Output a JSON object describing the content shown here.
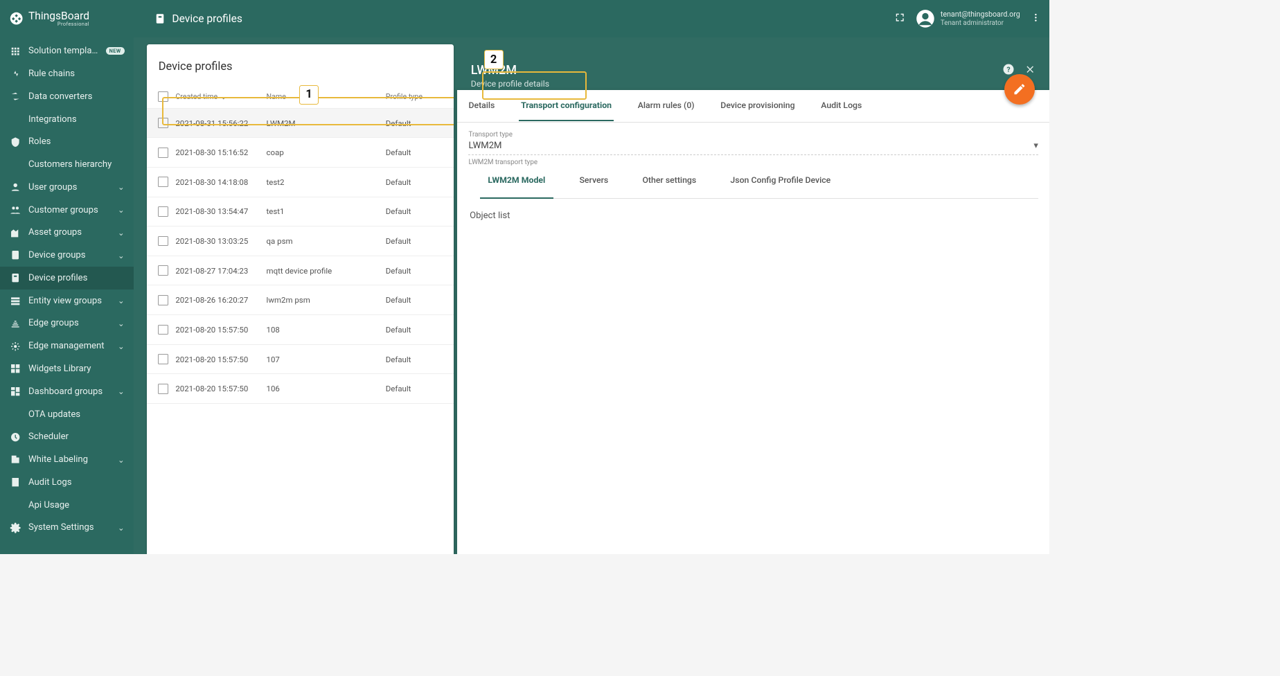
{
  "brand": {
    "name": "ThingsBoard",
    "edition": "Professional"
  },
  "header": {
    "page_title": "Device profiles",
    "user_email": "tenant@thingsboard.org",
    "user_role": "Tenant administrator"
  },
  "sidebar": {
    "items": [
      {
        "icon": "apps",
        "label": "Solution templates",
        "badge": "NEW"
      },
      {
        "icon": "rulechains",
        "label": "Rule chains"
      },
      {
        "icon": "converters",
        "label": "Data converters"
      },
      {
        "icon": "integrations",
        "label": "Integrations"
      },
      {
        "icon": "roles",
        "label": "Roles"
      },
      {
        "icon": "hierarchy",
        "label": "Customers hierarchy"
      },
      {
        "icon": "users",
        "label": "User groups",
        "expandable": true
      },
      {
        "icon": "customers",
        "label": "Customer groups",
        "expandable": true
      },
      {
        "icon": "assets",
        "label": "Asset groups",
        "expandable": true
      },
      {
        "icon": "devices",
        "label": "Device groups",
        "expandable": true
      },
      {
        "icon": "deviceprofiles",
        "label": "Device profiles",
        "active": true
      },
      {
        "icon": "entityviews",
        "label": "Entity view groups",
        "expandable": true
      },
      {
        "icon": "edge",
        "label": "Edge groups",
        "expandable": true
      },
      {
        "icon": "edgemgmt",
        "label": "Edge management",
        "expandable": true
      },
      {
        "icon": "widgets",
        "label": "Widgets Library"
      },
      {
        "icon": "dashboards",
        "label": "Dashboard groups",
        "expandable": true
      },
      {
        "icon": "ota",
        "label": "OTA updates"
      },
      {
        "icon": "scheduler",
        "label": "Scheduler"
      },
      {
        "icon": "whitelabel",
        "label": "White Labeling",
        "expandable": true
      },
      {
        "icon": "audit",
        "label": "Audit Logs"
      },
      {
        "icon": "api",
        "label": "Api Usage"
      },
      {
        "icon": "settings",
        "label": "System Settings",
        "expandable": true
      }
    ]
  },
  "table": {
    "title": "Device profiles",
    "columns": {
      "created": "Created time",
      "name": "Name",
      "profile_type": "Profile type"
    },
    "rows": [
      {
        "created": "2021-08-31 15:56:22",
        "name": "LWM2M",
        "type": "Default",
        "highlight": true
      },
      {
        "created": "2021-08-30 15:16:52",
        "name": "coap",
        "type": "Default"
      },
      {
        "created": "2021-08-30 14:18:08",
        "name": "test2",
        "type": "Default"
      },
      {
        "created": "2021-08-30 13:54:47",
        "name": "test1",
        "type": "Default"
      },
      {
        "created": "2021-08-30 13:03:25",
        "name": "qa psm",
        "type": "Default"
      },
      {
        "created": "2021-08-27 17:04:23",
        "name": "mqtt device profile",
        "type": "Default"
      },
      {
        "created": "2021-08-26 16:20:27",
        "name": "lwm2m psm",
        "type": "Default"
      },
      {
        "created": "2021-08-20 15:57:50",
        "name": "108",
        "type": "Default"
      },
      {
        "created": "2021-08-20 15:57:50",
        "name": "107",
        "type": "Default"
      },
      {
        "created": "2021-08-20 15:57:50",
        "name": "106",
        "type": "Default"
      }
    ]
  },
  "detail": {
    "title": "LWM2M",
    "subtitle": "Device profile details",
    "tabs": {
      "details": "Details",
      "transport": "Transport configuration",
      "alarm": "Alarm rules (0)",
      "provisioning": "Device provisioning",
      "audit": "Audit Logs"
    },
    "transport_type_label": "Transport type",
    "transport_type_value": "LWM2M",
    "transport_type_help": "LWM2M transport type",
    "subtabs": {
      "model": "LWM2M Model",
      "servers": "Servers",
      "other": "Other settings",
      "json": "Json Config Profile Device"
    },
    "object_list": "Object list"
  },
  "callouts": {
    "one": "1",
    "two": "2"
  }
}
